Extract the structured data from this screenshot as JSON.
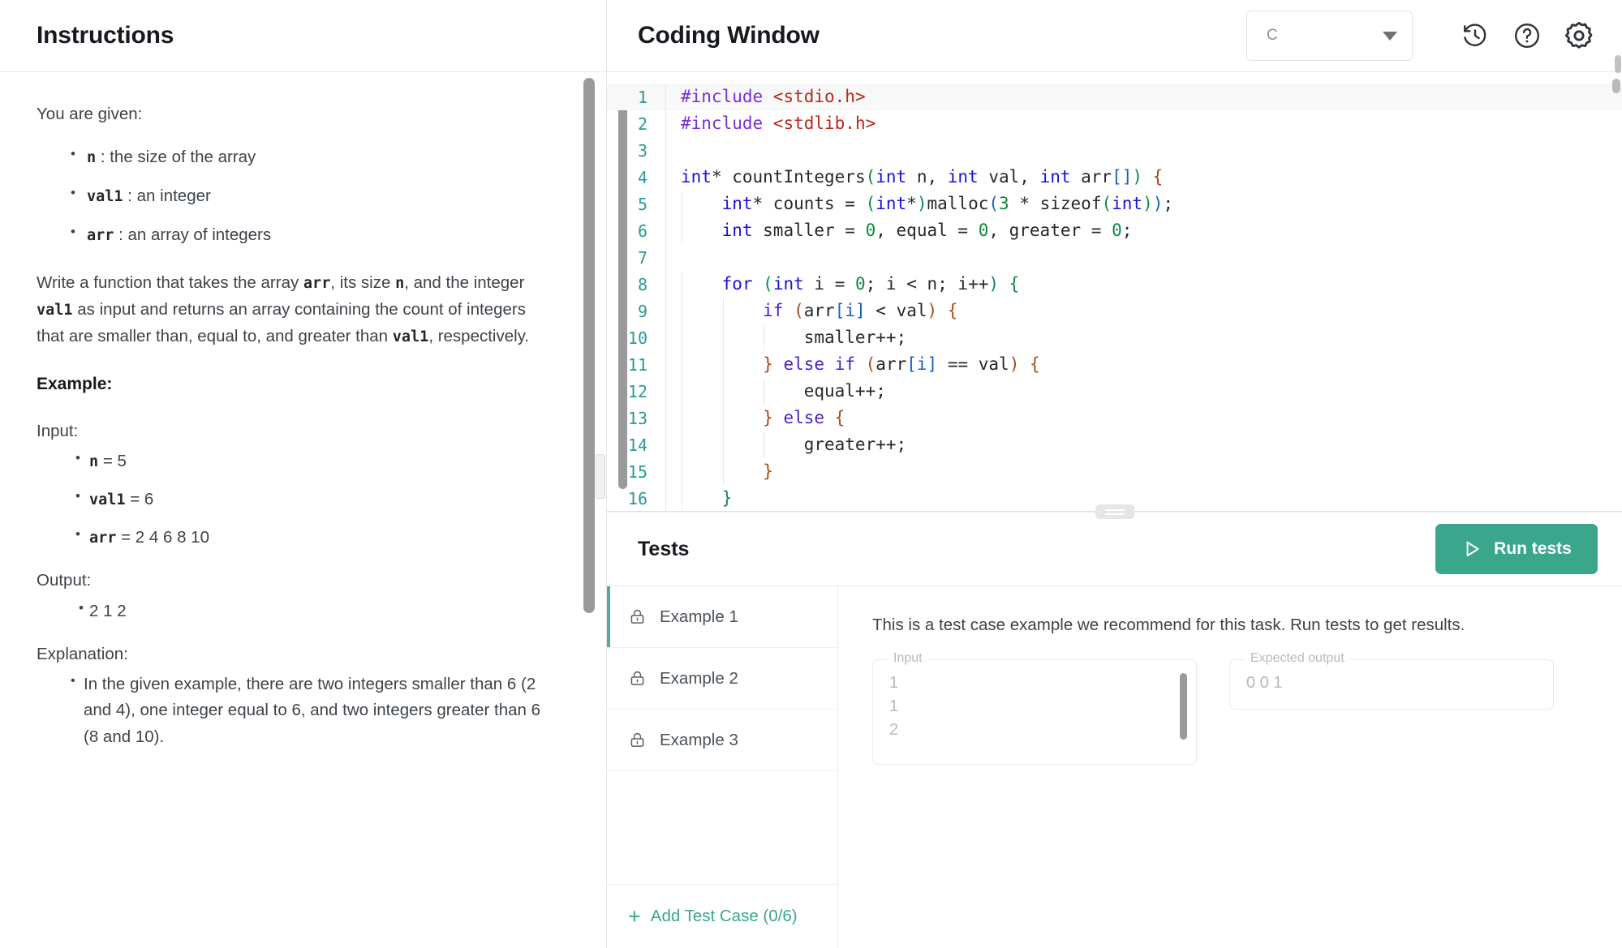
{
  "instructions": {
    "title": "Instructions",
    "intro": "You are given:",
    "given_items": [
      {
        "code": "n",
        "text": ": the size of the array"
      },
      {
        "code": "val1",
        "text": ": an integer"
      },
      {
        "code": "arr",
        "text": ": an array of integers"
      }
    ],
    "description_parts": [
      {
        "type": "text",
        "value": "Write a function that takes the array "
      },
      {
        "type": "code",
        "value": "arr"
      },
      {
        "type": "text",
        "value": ", its size "
      },
      {
        "type": "code",
        "value": "n"
      },
      {
        "type": "text",
        "value": ", and the integer "
      },
      {
        "type": "code",
        "value": "val1"
      },
      {
        "type": "text",
        "value": " as input and returns an array containing the count of integers that are smaller than, equal to, and greater than "
      },
      {
        "type": "code",
        "value": "val1"
      },
      {
        "type": "text",
        "value": ", respectively."
      }
    ],
    "example_heading": "Example:",
    "input_label": "Input:",
    "input_items": [
      {
        "code": "n",
        "text": "= 5"
      },
      {
        "code": "val1",
        "text": "= 6"
      },
      {
        "code": "arr",
        "text": "= 2 4 6 8 10"
      }
    ],
    "output_label": "Output:",
    "output_value": "2 1 2",
    "explanation_label": "Explanation:",
    "explanation_text": "In the given example, there are two integers smaller than 6 (2 and 4), one integer equal to 6, and two integers greater than 6 (8 and 10)."
  },
  "coding": {
    "title": "Coding Window",
    "language_selected": "C",
    "icons": {
      "history": "history-icon",
      "help": "help-circle-icon",
      "settings": "gear-icon"
    },
    "code_lines": [
      {
        "n": "1",
        "segments": [
          {
            "c": "pre",
            "t": "#include "
          },
          {
            "c": "str",
            "t": "<stdio.h>"
          }
        ],
        "highlight": true
      },
      {
        "n": "2",
        "segments": [
          {
            "c": "pre",
            "t": "#include "
          },
          {
            "c": "str",
            "t": "<stdlib.h>"
          }
        ]
      },
      {
        "n": "3",
        "segments": []
      },
      {
        "n": "4",
        "segments": [
          {
            "c": "typ",
            "t": "int"
          },
          {
            "c": "",
            "t": "* countIntegers"
          },
          {
            "c": "br1",
            "t": "("
          },
          {
            "c": "typ",
            "t": "int"
          },
          {
            "c": "",
            "t": " n, "
          },
          {
            "c": "typ",
            "t": "int"
          },
          {
            "c": "",
            "t": " val, "
          },
          {
            "c": "typ",
            "t": "int"
          },
          {
            "c": "",
            "t": " arr"
          },
          {
            "c": "br3",
            "t": "[]"
          },
          {
            "c": "br1",
            "t": ")"
          },
          {
            "c": "br2",
            "t": " {"
          }
        ]
      },
      {
        "n": "5",
        "segments": [
          {
            "c": "",
            "t": "    "
          },
          {
            "c": "typ",
            "t": "int"
          },
          {
            "c": "",
            "t": "* counts = "
          },
          {
            "c": "br1",
            "t": "("
          },
          {
            "c": "typ",
            "t": "int"
          },
          {
            "c": "",
            "t": "*"
          },
          {
            "c": "br1",
            "t": ")"
          },
          {
            "c": "",
            "t": "malloc"
          },
          {
            "c": "br3",
            "t": "("
          },
          {
            "c": "num",
            "t": "3"
          },
          {
            "c": "",
            "t": " * sizeof"
          },
          {
            "c": "br1",
            "t": "("
          },
          {
            "c": "typ",
            "t": "int"
          },
          {
            "c": "br1",
            "t": ")"
          },
          {
            "c": "br3",
            "t": ")"
          },
          {
            "c": "",
            "t": ";"
          }
        ]
      },
      {
        "n": "6",
        "segments": [
          {
            "c": "",
            "t": "    "
          },
          {
            "c": "typ",
            "t": "int"
          },
          {
            "c": "",
            "t": " smaller = "
          },
          {
            "c": "num",
            "t": "0"
          },
          {
            "c": "",
            "t": ", equal = "
          },
          {
            "c": "num",
            "t": "0"
          },
          {
            "c": "",
            "t": ", greater = "
          },
          {
            "c": "num",
            "t": "0"
          },
          {
            "c": "",
            "t": ";"
          }
        ]
      },
      {
        "n": "7",
        "segments": []
      },
      {
        "n": "8",
        "segments": [
          {
            "c": "",
            "t": "    "
          },
          {
            "c": "kw",
            "t": "for"
          },
          {
            "c": "",
            "t": " "
          },
          {
            "c": "br1",
            "t": "("
          },
          {
            "c": "typ",
            "t": "int"
          },
          {
            "c": "",
            "t": " i = "
          },
          {
            "c": "num",
            "t": "0"
          },
          {
            "c": "",
            "t": "; i < n; i++"
          },
          {
            "c": "br1",
            "t": ")"
          },
          {
            "c": "br1",
            "t": " {"
          }
        ]
      },
      {
        "n": "9",
        "segments": [
          {
            "c": "",
            "t": "        "
          },
          {
            "c": "kw2",
            "t": "if"
          },
          {
            "c": "",
            "t": " "
          },
          {
            "c": "br2",
            "t": "("
          },
          {
            "c": "",
            "t": "arr"
          },
          {
            "c": "br3",
            "t": "[i]"
          },
          {
            "c": "",
            "t": " < val"
          },
          {
            "c": "br2",
            "t": ")"
          },
          {
            "c": "br2",
            "t": " {"
          }
        ]
      },
      {
        "n": "10",
        "segments": [
          {
            "c": "",
            "t": "            smaller++;"
          }
        ]
      },
      {
        "n": "11",
        "segments": [
          {
            "c": "br2",
            "t": "        }"
          },
          {
            "c": "",
            "t": " "
          },
          {
            "c": "kw2",
            "t": "else"
          },
          {
            "c": "",
            "t": " "
          },
          {
            "c": "kw2",
            "t": "if"
          },
          {
            "c": "",
            "t": " "
          },
          {
            "c": "br2",
            "t": "("
          },
          {
            "c": "",
            "t": "arr"
          },
          {
            "c": "br3",
            "t": "[i]"
          },
          {
            "c": "",
            "t": " == val"
          },
          {
            "c": "br2",
            "t": ")"
          },
          {
            "c": "br2",
            "t": " {"
          }
        ]
      },
      {
        "n": "12",
        "segments": [
          {
            "c": "",
            "t": "            equal++;"
          }
        ]
      },
      {
        "n": "13",
        "segments": [
          {
            "c": "br2",
            "t": "        }"
          },
          {
            "c": "",
            "t": " "
          },
          {
            "c": "kw2",
            "t": "else"
          },
          {
            "c": "br2",
            "t": " {"
          }
        ]
      },
      {
        "n": "14",
        "segments": [
          {
            "c": "",
            "t": "            greater++;"
          }
        ]
      },
      {
        "n": "15",
        "segments": [
          {
            "c": "br2",
            "t": "        }"
          }
        ]
      },
      {
        "n": "16",
        "segments": [
          {
            "c": "br1",
            "t": "    }"
          }
        ]
      }
    ]
  },
  "tests": {
    "title": "Tests",
    "run_label": "Run tests",
    "cases": [
      {
        "label": "Example 1",
        "locked": true,
        "selected": true
      },
      {
        "label": "Example 2",
        "locked": true,
        "selected": false
      },
      {
        "label": "Example 3",
        "locked": true,
        "selected": false
      }
    ],
    "add_case_label": "Add Test Case (0/6)",
    "detail": {
      "note": "This is a test case example we recommend for this task. Run tests to get results.",
      "input_label": "Input",
      "input_value": "1\n1\n2",
      "expected_label": "Expected output",
      "expected_value": "0 0 1"
    }
  },
  "colors": {
    "accent_teal": "#3aa68c",
    "selected_border": "#5aa6a0",
    "line_number": "#2a9a94"
  }
}
